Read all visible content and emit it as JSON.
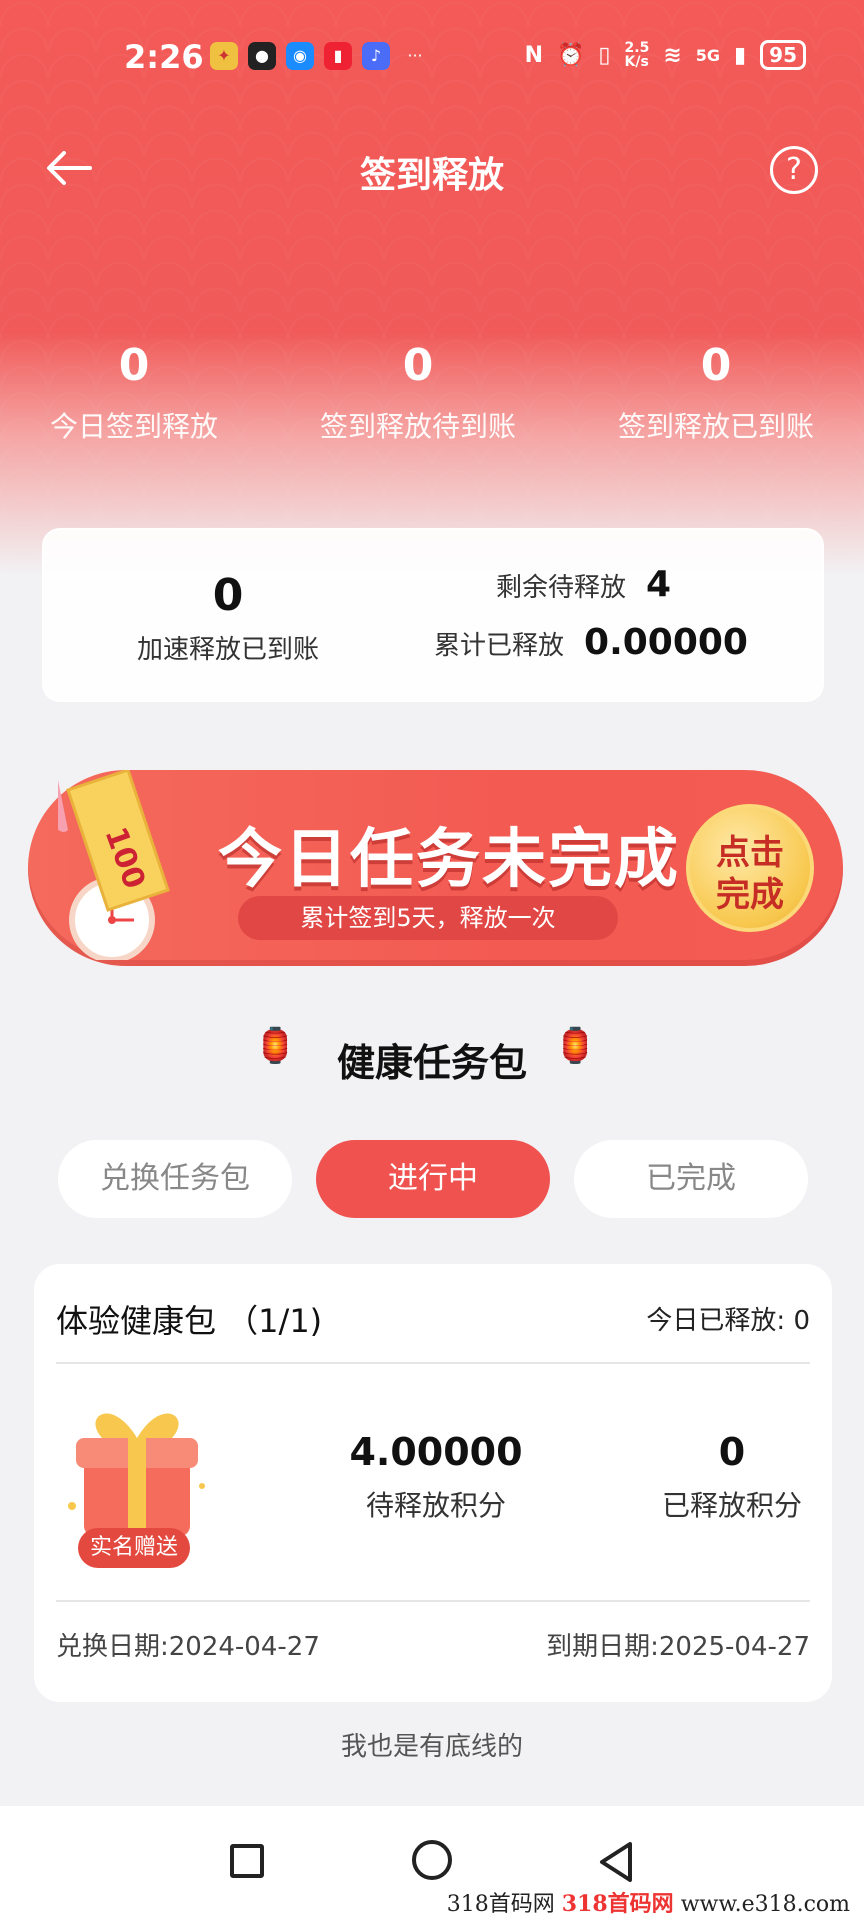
{
  "status_bar": {
    "time": "2:26",
    "network_speed": "2.5\nK/s",
    "signal": "5G",
    "battery": "95"
  },
  "nav": {
    "title": "签到释放",
    "help": "?"
  },
  "stats": [
    {
      "value": "0",
      "label": "今日签到释放"
    },
    {
      "value": "0",
      "label": "签到释放待到账"
    },
    {
      "value": "0",
      "label": "签到释放已到账"
    }
  ],
  "summary": {
    "accel_value": "0",
    "accel_label": "加速释放已到账",
    "remaining_label": "剩余待释放",
    "remaining_value": "4",
    "released_label": "累计已释放",
    "released_value": "0.00000"
  },
  "banner": {
    "title": "今日任务未完成",
    "subtitle": "累计签到5天，释放一次",
    "button": "点击\n完成",
    "ticket": "100"
  },
  "section": {
    "title": "健康任务包"
  },
  "tabs": [
    {
      "label": "兑换任务包",
      "active": false
    },
    {
      "label": "进行中",
      "active": true
    },
    {
      "label": "已完成",
      "active": false
    }
  ],
  "task": {
    "title": "体验健康包 （1/1)",
    "today_released": "今日已释放:  0",
    "badge": "实名赠送",
    "pending_value": "4.00000",
    "pending_label": "待释放积分",
    "released_value": "0",
    "released_label": "已释放积分",
    "exchange_date": "兑换日期:2024-04-27",
    "expire_date": "到期日期:2025-04-27"
  },
  "footer": {
    "text": "我也是有底线的"
  },
  "watermark": {
    "prefix": "318首码网",
    "brand": "318首码网",
    "url": "www.e318.com"
  },
  "colors": {
    "primary_red": "#f0524f",
    "header_red": "#f35a58",
    "gold": "#f8c84e"
  }
}
